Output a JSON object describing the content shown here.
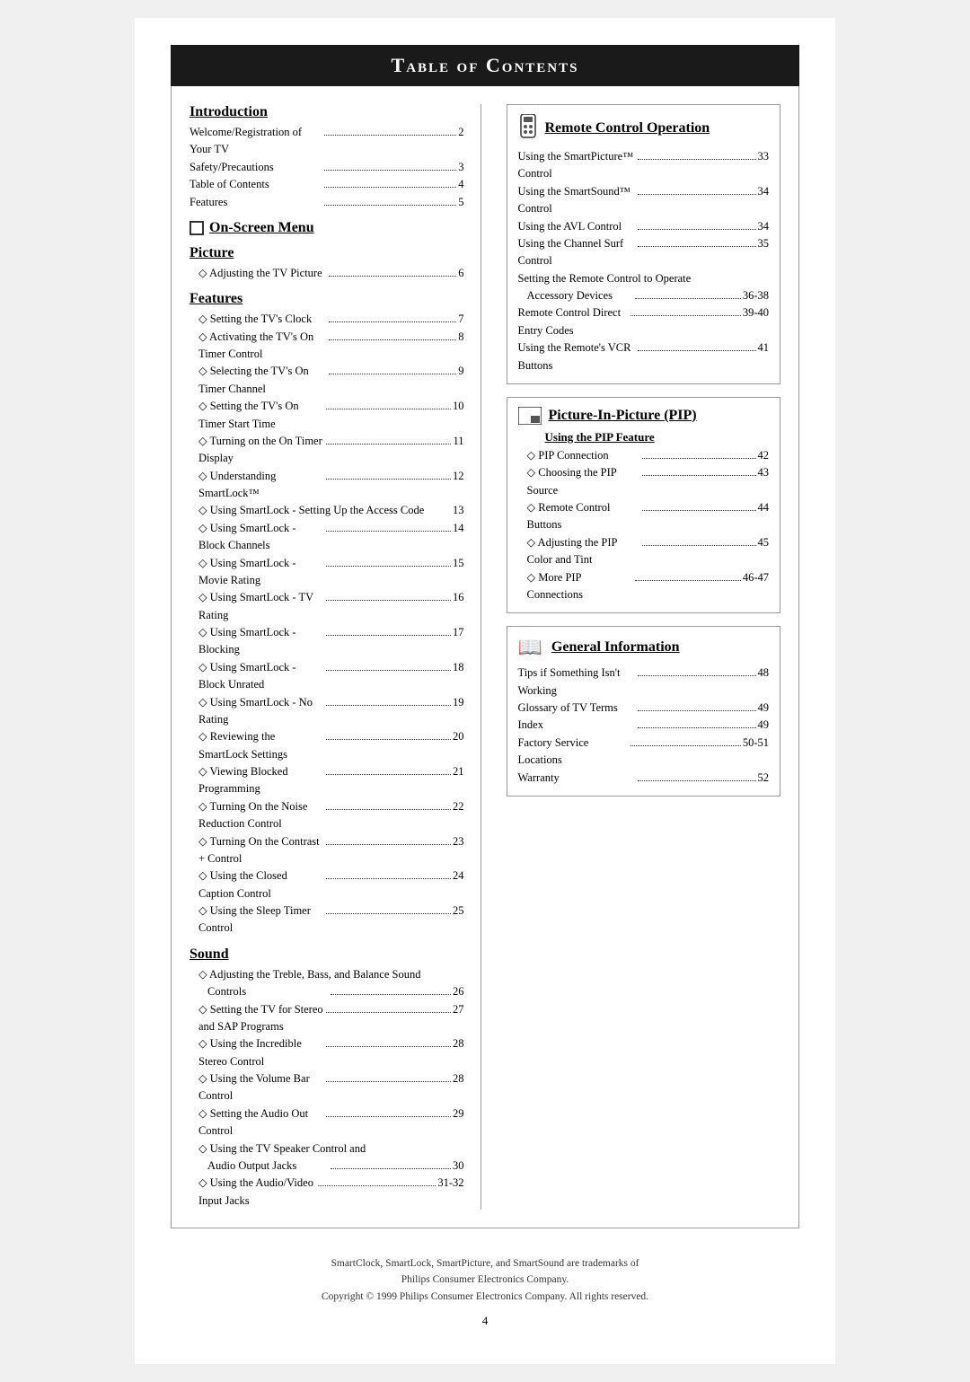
{
  "page": {
    "title": "Table of Contents",
    "page_number": "4",
    "footer": "SmartClock, SmartLock, SmartPicture, and SmartSound are trademarks of\nPhilips Consumer Electronics Company.\nCopyright © 1999 Philips Consumer Electronics Company. All rights reserved."
  },
  "left_col": {
    "introduction": {
      "title": "Introduction",
      "items": [
        {
          "label": "Welcome/Registration of Your TV",
          "page": "2"
        },
        {
          "label": "Safety/Precautions",
          "page": "3"
        },
        {
          "label": "Table of Contents",
          "page": "4"
        },
        {
          "label": "Features",
          "page": "5"
        }
      ]
    },
    "on_screen_menu": {
      "title": "On-Screen Menu"
    },
    "picture": {
      "title": "Picture",
      "items": [
        {
          "label": "◇ Adjusting the TV Picture",
          "page": "6",
          "diamond": true
        }
      ]
    },
    "features": {
      "title": "Features",
      "items": [
        {
          "label": "◇ Setting the TV's Clock",
          "page": "7"
        },
        {
          "label": "◇ Activating the TV's On Timer Control",
          "page": "8"
        },
        {
          "label": "◇ Selecting the TV's On Timer Channel",
          "page": "9"
        },
        {
          "label": "◇ Setting the TV's On Timer Start Time",
          "page": "10"
        },
        {
          "label": "◇ Turning on the On Timer Display",
          "page": "11"
        },
        {
          "label": "◇ Understanding SmartLock™",
          "page": "12"
        },
        {
          "label": "◇ Using SmartLock - Setting Up the Access Code",
          "page": "13"
        },
        {
          "label": "◇ Using SmartLock - Block Channels",
          "page": "14"
        },
        {
          "label": "◇ Using SmartLock - Movie Rating",
          "page": "15"
        },
        {
          "label": "◇ Using SmartLock - TV Rating",
          "page": "16"
        },
        {
          "label": "◇ Using SmartLock - Blocking",
          "page": "17"
        },
        {
          "label": "◇ Using SmartLock - Block Unrated",
          "page": "18"
        },
        {
          "label": "◇ Using SmartLock - No Rating",
          "page": "19"
        },
        {
          "label": "◇ Reviewing the SmartLock Settings",
          "page": "20"
        },
        {
          "label": "◇ Viewing Blocked Programming",
          "page": "21"
        },
        {
          "label": "◇ Turning On the Noise Reduction Control",
          "page": "22"
        },
        {
          "label": "◇ Turning On the Contrast + Control",
          "page": "23"
        },
        {
          "label": "◇ Using the Closed Caption Control",
          "page": "24"
        },
        {
          "label": "◇ Using the Sleep Timer Control",
          "page": "25"
        }
      ]
    },
    "sound": {
      "title": "Sound",
      "items": [
        {
          "label": "◇ Adjusting the Treble, Bass, and Balance Sound Controls",
          "page": "26",
          "multiline": true
        },
        {
          "label": "◇ Setting the TV for Stereo and SAP Programs",
          "page": "27"
        },
        {
          "label": "◇ Using the Incredible Stereo Control",
          "page": "28"
        },
        {
          "label": "◇ Using the Volume Bar Control",
          "page": "28"
        },
        {
          "label": "◇ Setting the Audio Out Control",
          "page": "29"
        },
        {
          "label": "◇ Using the TV Speaker Control and Audio Output Jacks",
          "page": "30",
          "multiline": true
        },
        {
          "label": "◇ Using the Audio/Video Input Jacks",
          "page": "31-32"
        }
      ]
    }
  },
  "right_col": {
    "remote_control": {
      "title": "Remote Control Operation",
      "items": [
        {
          "label": "Using the SmartPicture™ Control",
          "page": "33"
        },
        {
          "label": "Using the SmartSound™ Control",
          "page": "34"
        },
        {
          "label": "Using the AVL Control",
          "page": "34"
        },
        {
          "label": "Using the Channel Surf Control",
          "page": "35"
        },
        {
          "label": "Setting the Remote Control to Operate Accessory Devices",
          "page": "36-38",
          "multiline": true
        },
        {
          "label": "Remote Control Direct Entry Codes",
          "page": "39-40"
        },
        {
          "label": "Using the Remote's VCR Buttons",
          "page": "41"
        }
      ]
    },
    "pip": {
      "title": "Picture-In-Picture (PIP)",
      "sub_title": "Using the PIP Feature",
      "items": [
        {
          "label": "◇ PIP Connection",
          "page": "42"
        },
        {
          "label": "◇ Choosing the PIP Source",
          "page": "43"
        },
        {
          "label": "◇ Remote Control Buttons",
          "page": "44"
        },
        {
          "label": "◇ Adjusting the PIP Color and Tint",
          "page": "45"
        },
        {
          "label": "◇ More PIP Connections",
          "page": "46-47"
        }
      ]
    },
    "general_info": {
      "title": "General Information",
      "items": [
        {
          "label": "Tips if Something Isn't Working",
          "page": "48"
        },
        {
          "label": "Glossary of TV Terms",
          "page": "49"
        },
        {
          "label": "Index",
          "page": "49"
        },
        {
          "label": "Factory Service Locations",
          "page": "50-51"
        },
        {
          "label": "Warranty",
          "page": "52"
        }
      ]
    }
  }
}
